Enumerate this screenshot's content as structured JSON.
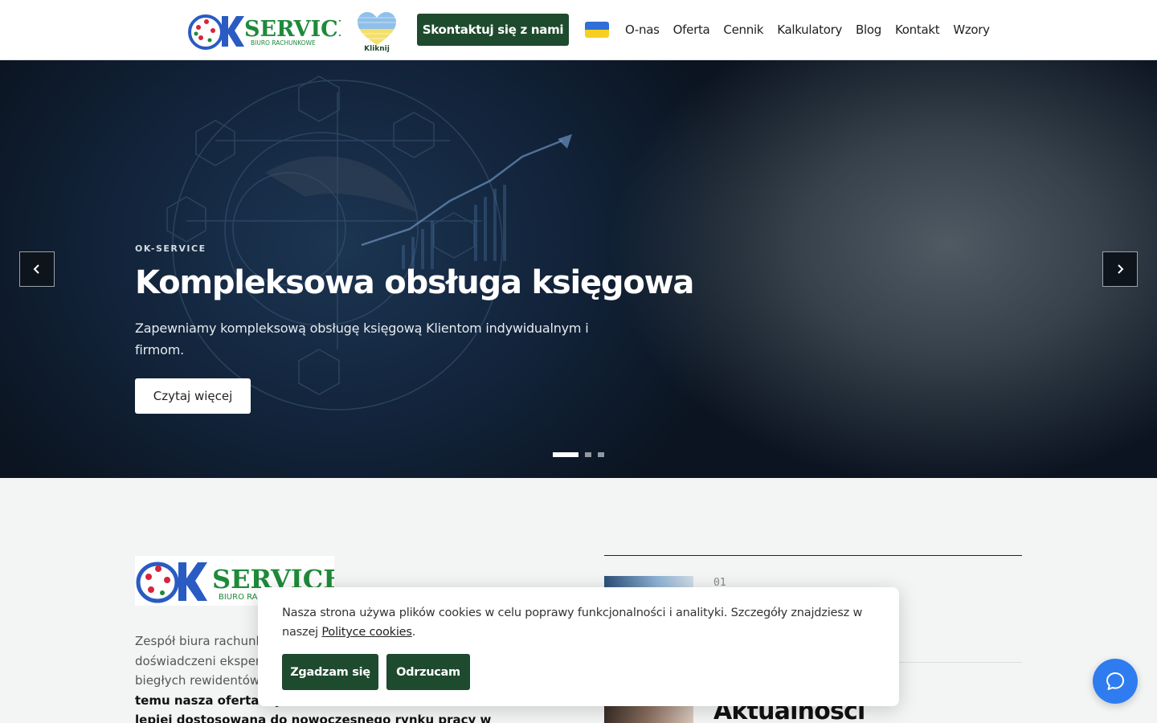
{
  "header": {
    "logo_alt": "OK SERVICE Biuro Rachunkowe",
    "logo_text": "SERVICE",
    "logo_sub": "BIURO  RACHUNKOWE",
    "ukraine_heart_label": "Kliknij",
    "contact_button": "Skontaktuj się z nami",
    "nav": [
      "O-nas",
      "Oferta",
      "Cennik",
      "Kalkulatory",
      "Blog",
      "Kontakt",
      "Wzory"
    ]
  },
  "hero": {
    "eyebrow": "OK-SERVICE",
    "title": "Kompleksowa obsługa księgowa",
    "description": "Zapewniamy kompleksową obsługę księgową Klientom indywidualnym i firmom.",
    "button": "Czytaj więcej",
    "slides_total": 3,
    "active_slide": 1
  },
  "about": {
    "text_start": "Zespół biura rachunko",
    "line2": "doświadczeni eksper",
    "line3": "biegłych rewidentów,",
    "bold_line4": "temu nasza oferta wy",
    "bold_line5": "lepiej dostosowana do nowoczesnego rynku pracy w Polsce."
  },
  "side": {
    "item_number": "01",
    "news_title": "Aktualności"
  },
  "cookie": {
    "text": "Nasza strona używa plików cookies w celu poprawy funkcjonalności i analityki. Szczegóły znajdziesz w naszej ",
    "link": "Polityce cookies",
    "after_link": ".",
    "accept": "Zgadzam się",
    "reject": "Odrzucam"
  },
  "colors": {
    "brand_green": "#1e4a2d",
    "chat_blue": "#2f7cf0",
    "flag_blue": "#2f6fd6",
    "flag_yellow": "#f6cf22"
  },
  "icons": [
    "chevron-left-icon",
    "chevron-right-icon",
    "chat-bubble-icon",
    "heart-icon"
  ]
}
